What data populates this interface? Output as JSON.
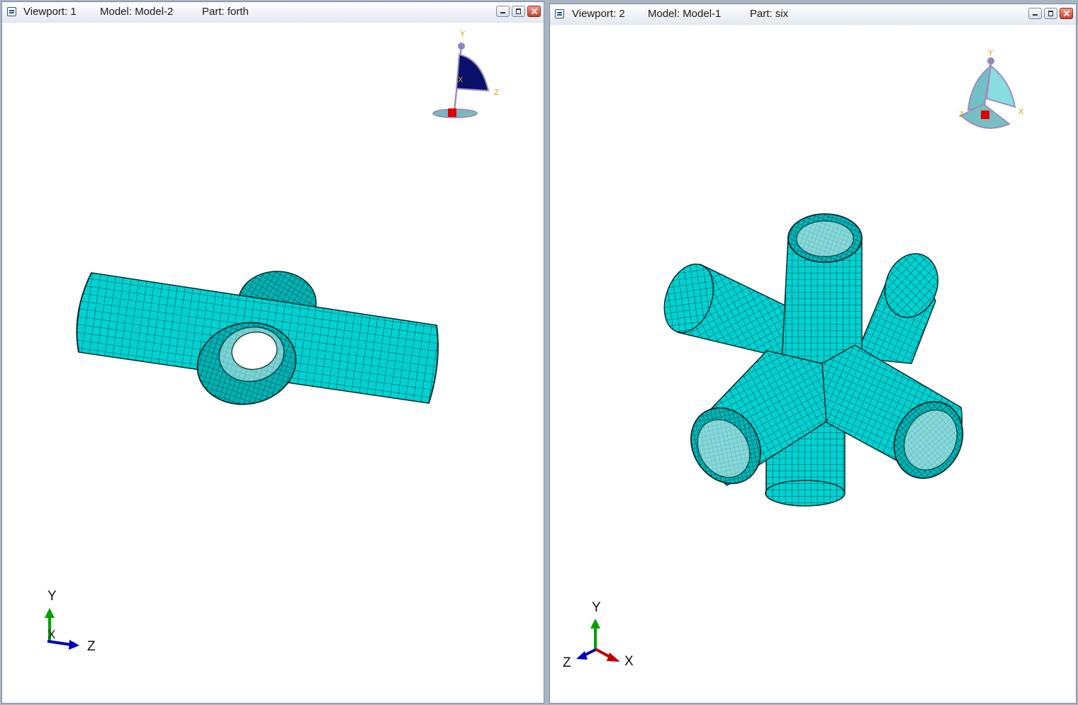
{
  "viewports": [
    {
      "viewport_label": "Viewport: 1",
      "model_label": "Model: Model-2",
      "part_label": "Part: forth",
      "view_cube": {
        "top": "Y",
        "side": "Z",
        "center": "X"
      },
      "triad": {
        "up": "Y",
        "right": "Z",
        "out": "X"
      }
    },
    {
      "viewport_label": "Viewport: 2",
      "model_label": "Model: Model-1",
      "part_label": "Part: six",
      "view_cube": {
        "top": "Y",
        "right": "X",
        "left": "Z"
      },
      "triad": {
        "up": "Y",
        "right": "X",
        "left": "Z"
      }
    }
  ],
  "colors": {
    "mesh": "#00d2d2",
    "mesh_dark": "#00a4a6",
    "mesh_line": "#0b2a2a",
    "axis_x": "#c00000",
    "axis_y": "#00a000",
    "axis_z": "#0000c0"
  }
}
